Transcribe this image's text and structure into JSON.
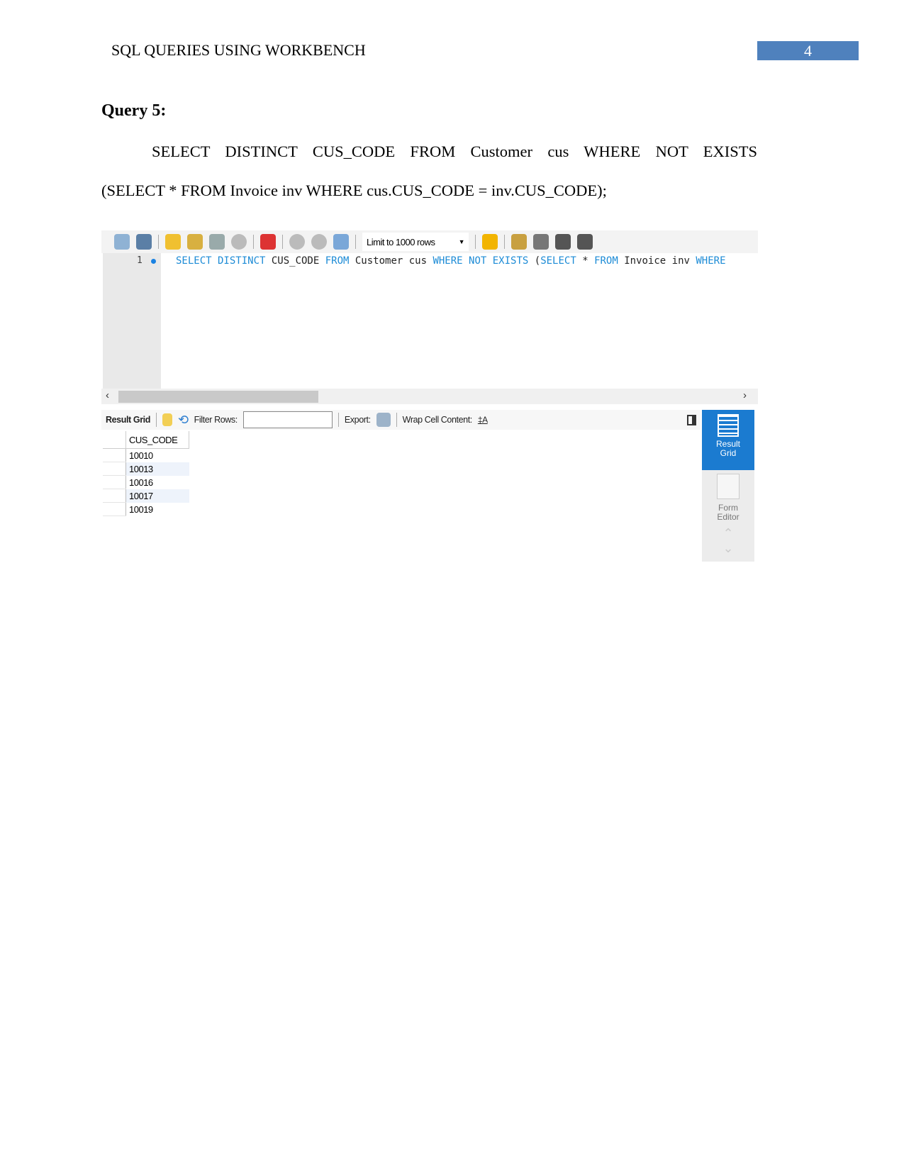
{
  "header": {
    "title": "SQL QUERIES USING WORKBENCH",
    "page_number": "4",
    "accent": "#4f81bd"
  },
  "query": {
    "title": "Query 5:",
    "line1": "SELECT DISTINCT CUS_CODE FROM Customer cus WHERE NOT EXISTS",
    "line2": "(SELECT * FROM Invoice inv WHERE cus.CUS_CODE = inv.CUS_CODE);"
  },
  "workbench": {
    "toolbar": {
      "limit_label": "Limit to 1000 rows",
      "icons": [
        "open-folder-icon",
        "save-icon",
        "execute-icon",
        "execute-current-icon",
        "explain-icon",
        "stop-icon",
        "toggle-error-icon",
        "commit-icon",
        "rollback-icon",
        "autocommit-icon",
        "bookmark-icon",
        "beautify-icon",
        "find-icon",
        "invisible-chars-icon",
        "wrap-icon"
      ]
    },
    "editor": {
      "line_number": "1",
      "tokens": [
        [
          "SELECT DISTINCT ",
          "kw"
        ],
        [
          "CUS_CODE ",
          ""
        ],
        [
          "FROM ",
          "kw"
        ],
        [
          "Customer cus ",
          ""
        ],
        [
          "WHERE NOT EXISTS ",
          "kw"
        ],
        [
          "(",
          ""
        ],
        [
          "SELECT ",
          "kw"
        ],
        [
          "* ",
          ""
        ],
        [
          "FROM ",
          "kw"
        ],
        [
          "Invoice inv ",
          ""
        ],
        [
          "WHERE",
          "kw"
        ]
      ]
    },
    "results": {
      "tab": "Result Grid",
      "filter_label": "Filter Rows:",
      "export_label": "Export:",
      "wrap_label": "Wrap Cell Content:",
      "column": "CUS_CODE",
      "rows": [
        "10010",
        "10013",
        "10016",
        "10017",
        "10019"
      ]
    },
    "side": {
      "result_grid": "Result Grid",
      "form_editor": "Form Editor",
      "accent": "#1b7bd0"
    }
  }
}
